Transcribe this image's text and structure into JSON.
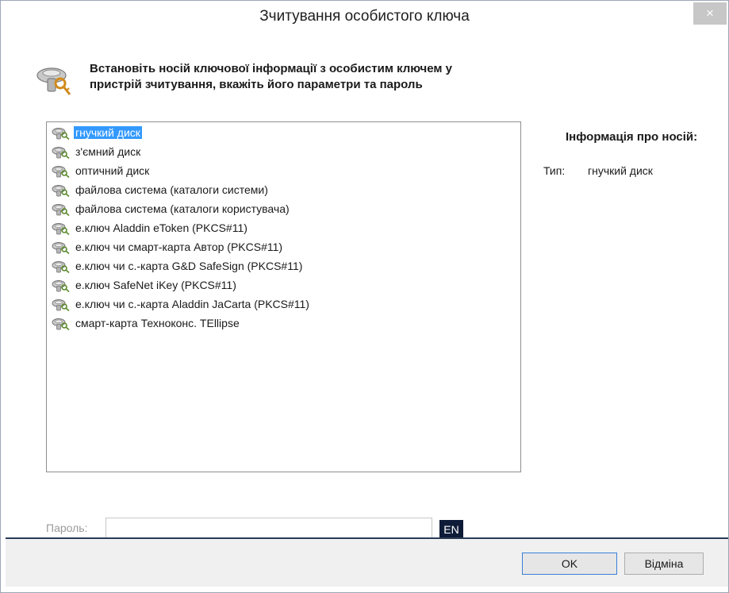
{
  "window": {
    "title": "Зчитування особистого ключа",
    "close_glyph": "×"
  },
  "header": {
    "icon": "key-reader-icon",
    "line1": "Встановіть носій ключової інформації з особистим ключем у",
    "line2": "пристрій зчитування, вкажіть його параметри та пароль"
  },
  "device_list": {
    "selected_index": 0,
    "items": [
      {
        "label": "гнучкий диск"
      },
      {
        "label": "з'ємний диск"
      },
      {
        "label": "оптичний диск"
      },
      {
        "label": "файлова система (каталоги системи)"
      },
      {
        "label": "файлова система (каталоги користувача)"
      },
      {
        "label": "е.ключ Aladdin eToken (PKCS#11)"
      },
      {
        "label": "е.ключ чи смарт-карта Автор (PKCS#11)"
      },
      {
        "label": "е.ключ чи с.-карта G&D SafeSign (PKCS#11)"
      },
      {
        "label": "е.ключ SafeNet iKey (PKCS#11)"
      },
      {
        "label": "е.ключ чи с.-карта Aladdin JaCarta (PKCS#11)"
      },
      {
        "label": "смарт-карта Техноконс. TEllipse"
      }
    ]
  },
  "info": {
    "title": "Інформація про носій:",
    "type_label": "Тип:",
    "type_value": "гнучкий диск"
  },
  "password": {
    "label": "Пароль:",
    "value": "",
    "lang": "EN"
  },
  "buttons": {
    "ok": "OK",
    "cancel": "Відміна"
  },
  "colors": {
    "selection": "#3399ff",
    "lang_badge": "#0e1b38",
    "separator": "#2b3c57"
  }
}
